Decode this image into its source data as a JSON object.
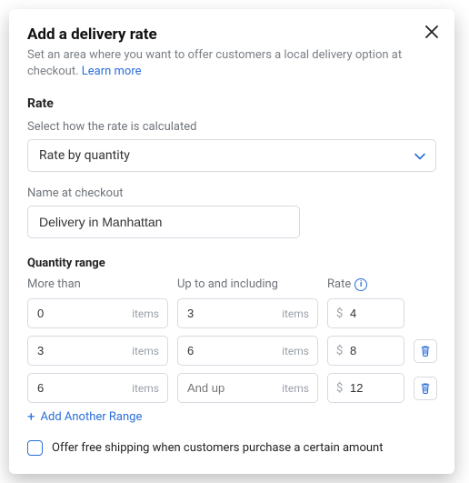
{
  "header": {
    "title": "Add a delivery rate",
    "subtitle_a": "Set an area where you want to offer customers a local delivery option at checkout.  ",
    "learn_more": "Learn more"
  },
  "rate": {
    "heading": "Rate",
    "calc_label": "Select how the rate is calculated",
    "calc_value": "Rate by quantity",
    "name_label": "Name at checkout",
    "name_value": "Delivery in Manhattan"
  },
  "quantity_range": {
    "heading": "Quantity range",
    "col_more_than": "More than",
    "col_up_to": "Up to and including",
    "col_rate": "Rate",
    "unit": "items",
    "currency": "$",
    "and_up_placeholder": "And up",
    "rows": [
      {
        "more_than": "0",
        "up_to": "3",
        "rate": "4",
        "deletable": false
      },
      {
        "more_than": "3",
        "up_to": "6",
        "rate": "8",
        "deletable": true
      },
      {
        "more_than": "6",
        "up_to": "",
        "rate": "12",
        "deletable": true
      }
    ],
    "add_label": "Add Another Range"
  },
  "free_shipping": {
    "checked": false,
    "label": "Offer free shipping when customers purchase a certain amount"
  }
}
